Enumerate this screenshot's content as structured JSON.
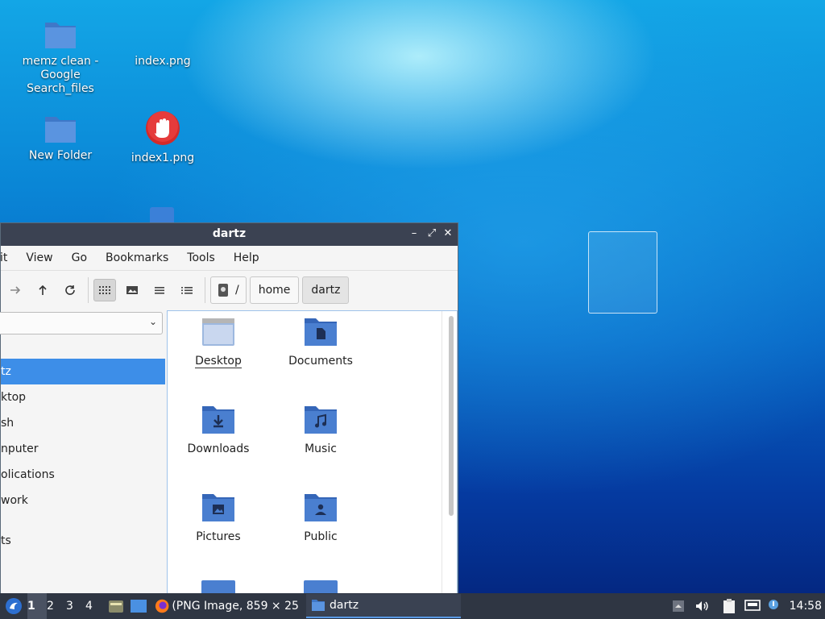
{
  "desktop": {
    "icons": [
      {
        "label": "memz clean - Google Search_files",
        "icon": "folder-icon"
      },
      {
        "label": "index.png",
        "icon": "image-file-icon"
      },
      {
        "label": "New Folder",
        "icon": "folder-icon"
      },
      {
        "label": "index1.png",
        "icon": "stop-hand-icon"
      }
    ]
  },
  "window": {
    "title": "dartz",
    "menu": [
      "it",
      "View",
      "Go",
      "Bookmarks",
      "Tools",
      "Help"
    ],
    "breadcrumb": [
      "/",
      "home",
      "dartz"
    ],
    "sidebar": {
      "places": [
        "tz",
        "ktop",
        "sh",
        "nputer",
        "olications",
        "work",
        "ts"
      ]
    },
    "files": [
      {
        "label": "Desktop",
        "icon": "desktop-folder-icon"
      },
      {
        "label": "Documents",
        "icon": "documents-folder-icon"
      },
      {
        "label": "Downloads",
        "icon": "downloads-folder-icon"
      },
      {
        "label": "Music",
        "icon": "music-folder-icon"
      },
      {
        "label": "Pictures",
        "icon": "pictures-folder-icon"
      },
      {
        "label": "Public",
        "icon": "public-folder-icon"
      }
    ]
  },
  "taskbar": {
    "workspaces": [
      "1",
      "2",
      "3",
      "4"
    ],
    "tasks": [
      {
        "label": "(PNG Image, 859 × 25 ...",
        "icon": "firefox-icon"
      },
      {
        "label": "dartz",
        "icon": "folder-icon"
      }
    ],
    "clock": "14:58"
  },
  "colors": {
    "accent": "#3d8ee8",
    "folder": "#4a7fd0",
    "taskbar": "#2f3643",
    "titlebar": "#3b4252"
  }
}
